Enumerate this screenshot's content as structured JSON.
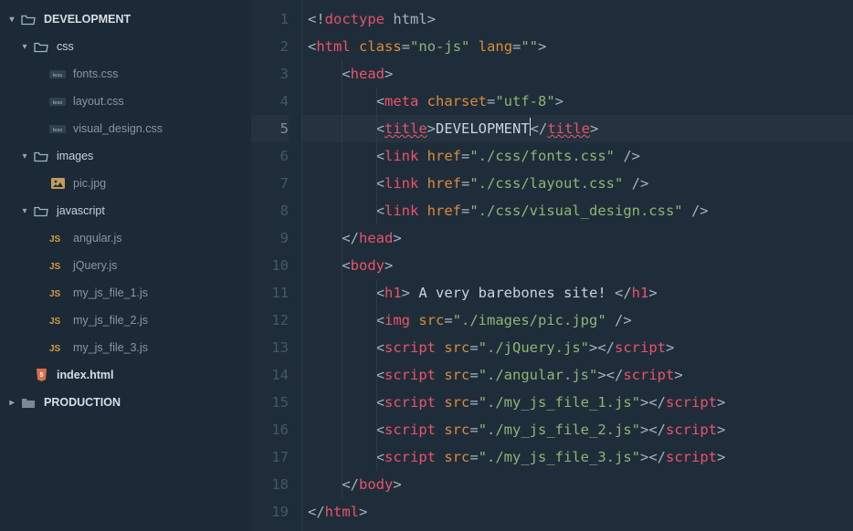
{
  "sidebar": {
    "items": [
      {
        "type": "folder-open",
        "label": "DEVELOPMENT",
        "depth": 0,
        "bold": true,
        "chev": "down"
      },
      {
        "type": "folder-open",
        "label": "css",
        "depth": 1,
        "chev": "down"
      },
      {
        "type": "less",
        "label": "fonts.css",
        "depth": 2,
        "dim": true
      },
      {
        "type": "less",
        "label": "layout.css",
        "depth": 2,
        "dim": true
      },
      {
        "type": "less",
        "label": "visual_design.css",
        "depth": 2,
        "dim": true
      },
      {
        "type": "folder-open",
        "label": "images",
        "depth": 1,
        "chev": "down"
      },
      {
        "type": "image",
        "label": "pic.jpg",
        "depth": 2,
        "dim": true
      },
      {
        "type": "folder-open",
        "label": "javascript",
        "depth": 1,
        "chev": "down"
      },
      {
        "type": "js",
        "label": "angular.js",
        "depth": 2,
        "dim": true
      },
      {
        "type": "js",
        "label": "jQuery.js",
        "depth": 2,
        "dim": true
      },
      {
        "type": "js",
        "label": "my_js_file_1.js",
        "depth": 2,
        "dim": true
      },
      {
        "type": "js",
        "label": "my_js_file_2.js",
        "depth": 2,
        "dim": true
      },
      {
        "type": "js",
        "label": "my_js_file_3.js",
        "depth": 2,
        "dim": true
      },
      {
        "type": "html",
        "label": "index.html",
        "depth": 1,
        "bold": true
      },
      {
        "type": "folder",
        "label": "PRODUCTION",
        "depth": 0,
        "bold": true,
        "chev": "right",
        "muted": true
      }
    ]
  },
  "editor": {
    "active_line": 5,
    "lines": [
      {
        "n": 1,
        "indent": 0,
        "tokens": [
          [
            "pun",
            "<!"
          ],
          [
            "doctype",
            "doctype"
          ],
          [
            "pun",
            " "
          ],
          [
            "kw",
            "html"
          ],
          [
            "pun",
            ">"
          ]
        ]
      },
      {
        "n": 2,
        "indent": 0,
        "tokens": [
          [
            "pun",
            "<"
          ],
          [
            "tag",
            "html"
          ],
          [
            "pun",
            " "
          ],
          [
            "attr",
            "class"
          ],
          [
            "pun",
            "="
          ],
          [
            "str",
            "\"no-js\""
          ],
          [
            "pun",
            " "
          ],
          [
            "attr",
            "lang"
          ],
          [
            "pun",
            "="
          ],
          [
            "str",
            "\"\""
          ],
          [
            "pun",
            ">"
          ]
        ]
      },
      {
        "n": 3,
        "indent": 1,
        "tokens": [
          [
            "pun",
            "<"
          ],
          [
            "tag",
            "head"
          ],
          [
            "pun",
            ">"
          ]
        ]
      },
      {
        "n": 4,
        "indent": 2,
        "tokens": [
          [
            "pun",
            "<"
          ],
          [
            "tag",
            "meta"
          ],
          [
            "pun",
            " "
          ],
          [
            "attr",
            "charset"
          ],
          [
            "pun",
            "="
          ],
          [
            "str",
            "\"utf-8\""
          ],
          [
            "pun",
            ">"
          ]
        ]
      },
      {
        "n": 5,
        "indent": 2,
        "tokens": [
          [
            "pun",
            "<"
          ],
          [
            "tag-err",
            "title"
          ],
          [
            "pun",
            ">"
          ],
          [
            "txt",
            "DEVELOPMENT"
          ],
          [
            "caret",
            ""
          ],
          [
            "pun",
            "</"
          ],
          [
            "tag-err",
            "title"
          ],
          [
            "pun",
            ">"
          ]
        ]
      },
      {
        "n": 6,
        "indent": 2,
        "tokens": [
          [
            "pun",
            "<"
          ],
          [
            "tag",
            "link"
          ],
          [
            "pun",
            " "
          ],
          [
            "attr",
            "href"
          ],
          [
            "pun",
            "="
          ],
          [
            "str",
            "\"./css/fonts.css\""
          ],
          [
            "pun",
            " />"
          ]
        ]
      },
      {
        "n": 7,
        "indent": 2,
        "tokens": [
          [
            "pun",
            "<"
          ],
          [
            "tag",
            "link"
          ],
          [
            "pun",
            " "
          ],
          [
            "attr",
            "href"
          ],
          [
            "pun",
            "="
          ],
          [
            "str",
            "\"./css/layout.css\""
          ],
          [
            "pun",
            " />"
          ]
        ]
      },
      {
        "n": 8,
        "indent": 2,
        "tokens": [
          [
            "pun",
            "<"
          ],
          [
            "tag",
            "link"
          ],
          [
            "pun",
            " "
          ],
          [
            "attr",
            "href"
          ],
          [
            "pun",
            "="
          ],
          [
            "str",
            "\"./css/visual_design.css\""
          ],
          [
            "pun",
            " />"
          ]
        ]
      },
      {
        "n": 9,
        "indent": 1,
        "tokens": [
          [
            "pun",
            "</"
          ],
          [
            "tag",
            "head"
          ],
          [
            "pun",
            ">"
          ]
        ]
      },
      {
        "n": 10,
        "indent": 1,
        "tokens": [
          [
            "pun",
            "<"
          ],
          [
            "tag",
            "body"
          ],
          [
            "pun",
            ">"
          ]
        ]
      },
      {
        "n": 11,
        "indent": 2,
        "tokens": [
          [
            "pun",
            "<"
          ],
          [
            "tag",
            "h1"
          ],
          [
            "pun",
            ">"
          ],
          [
            "txt",
            " A very barebones site! "
          ],
          [
            "pun",
            "</"
          ],
          [
            "tag",
            "h1"
          ],
          [
            "pun",
            ">"
          ]
        ]
      },
      {
        "n": 12,
        "indent": 2,
        "tokens": [
          [
            "pun",
            "<"
          ],
          [
            "tag",
            "img"
          ],
          [
            "pun",
            " "
          ],
          [
            "attr",
            "src"
          ],
          [
            "pun",
            "="
          ],
          [
            "str",
            "\"./images/pic.jpg\""
          ],
          [
            "pun",
            " />"
          ]
        ]
      },
      {
        "n": 13,
        "indent": 2,
        "tokens": [
          [
            "pun",
            "<"
          ],
          [
            "tag",
            "script"
          ],
          [
            "pun",
            " "
          ],
          [
            "attr",
            "src"
          ],
          [
            "pun",
            "="
          ],
          [
            "str",
            "\"./jQuery.js\""
          ],
          [
            "pun",
            "></"
          ],
          [
            "tag",
            "script"
          ],
          [
            "pun",
            ">"
          ]
        ]
      },
      {
        "n": 14,
        "indent": 2,
        "tokens": [
          [
            "pun",
            "<"
          ],
          [
            "tag",
            "script"
          ],
          [
            "pun",
            " "
          ],
          [
            "attr",
            "src"
          ],
          [
            "pun",
            "="
          ],
          [
            "str",
            "\"./angular.js\""
          ],
          [
            "pun",
            "></"
          ],
          [
            "tag",
            "script"
          ],
          [
            "pun",
            ">"
          ]
        ]
      },
      {
        "n": 15,
        "indent": 2,
        "tokens": [
          [
            "pun",
            "<"
          ],
          [
            "tag",
            "script"
          ],
          [
            "pun",
            " "
          ],
          [
            "attr",
            "src"
          ],
          [
            "pun",
            "="
          ],
          [
            "str",
            "\"./my_js_file_1.js\""
          ],
          [
            "pun",
            "></"
          ],
          [
            "tag",
            "script"
          ],
          [
            "pun",
            ">"
          ]
        ]
      },
      {
        "n": 16,
        "indent": 2,
        "tokens": [
          [
            "pun",
            "<"
          ],
          [
            "tag",
            "script"
          ],
          [
            "pun",
            " "
          ],
          [
            "attr",
            "src"
          ],
          [
            "pun",
            "="
          ],
          [
            "str",
            "\"./my_js_file_2.js\""
          ],
          [
            "pun",
            "></"
          ],
          [
            "tag",
            "script"
          ],
          [
            "pun",
            ">"
          ]
        ]
      },
      {
        "n": 17,
        "indent": 2,
        "tokens": [
          [
            "pun",
            "<"
          ],
          [
            "tag",
            "script"
          ],
          [
            "pun",
            " "
          ],
          [
            "attr",
            "src"
          ],
          [
            "pun",
            "="
          ],
          [
            "str",
            "\"./my_js_file_3.js\""
          ],
          [
            "pun",
            "></"
          ],
          [
            "tag",
            "script"
          ],
          [
            "pun",
            ">"
          ]
        ]
      },
      {
        "n": 18,
        "indent": 1,
        "tokens": [
          [
            "pun",
            "</"
          ],
          [
            "tag",
            "body"
          ],
          [
            "pun",
            ">"
          ]
        ]
      },
      {
        "n": 19,
        "indent": 0,
        "tokens": [
          [
            "pun",
            "</"
          ],
          [
            "tag",
            "html"
          ],
          [
            "pun",
            ">"
          ]
        ]
      }
    ]
  },
  "colors": {
    "bg": "#1f2d3a",
    "sidebar": "#1b2a36",
    "tag": "#eb5368",
    "attr": "#db8b3a",
    "str": "#8fb573"
  }
}
